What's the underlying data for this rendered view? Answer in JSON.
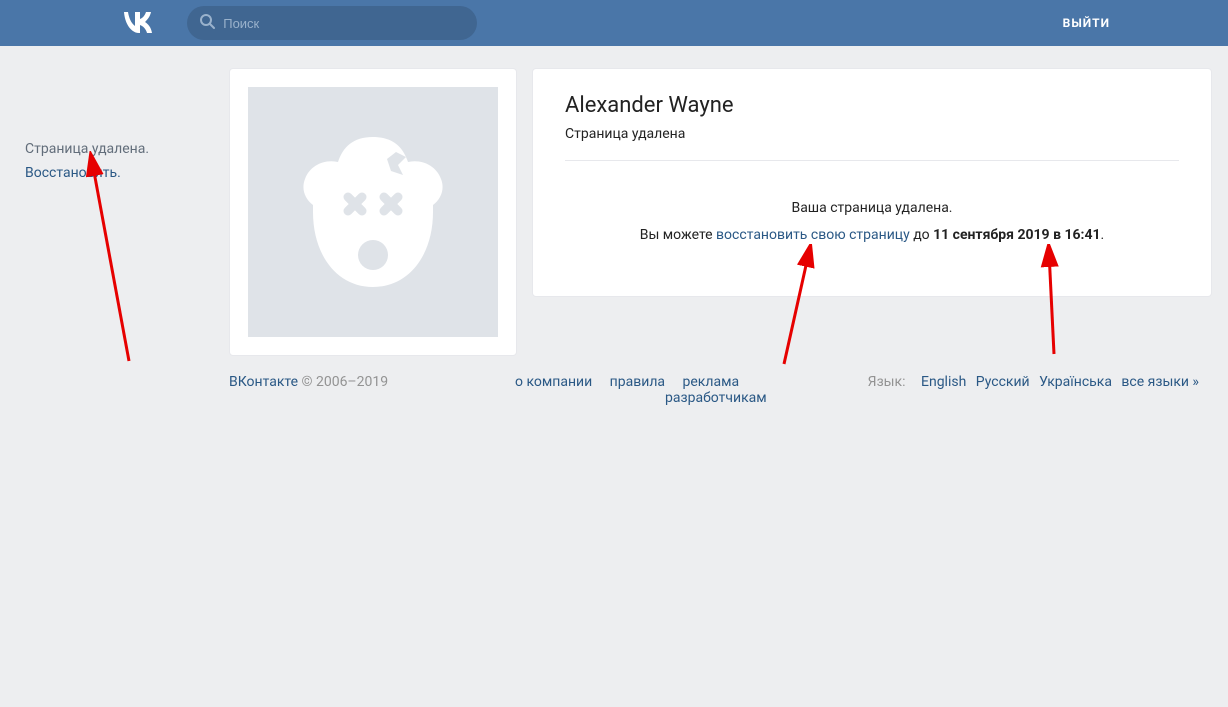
{
  "header": {
    "search_placeholder": "Поиск",
    "logout": "ВЫЙТИ"
  },
  "sidebar": {
    "status": "Страница удалена.",
    "restore": "Восстановить."
  },
  "profile": {
    "name": "Alexander Wayne",
    "subtitle": "Страница удалена",
    "notice_line1": "Ваша страница удалена.",
    "notice_pre": "Вы можете ",
    "notice_link": "восстановить свою страницу",
    "notice_mid": " до ",
    "notice_date": "11 сентября 2019 в 16:41",
    "notice_end": "."
  },
  "footer": {
    "brand": "ВКонтакте",
    "copyright": " © 2006–2019",
    "links": {
      "about": "о компании",
      "rules": "правила",
      "ads": "реклама",
      "dev": "разработчикам"
    },
    "lang_label": "Язык:",
    "langs": {
      "en": "English",
      "ru": "Русский",
      "ua": "Українська",
      "all": "все языки »"
    }
  }
}
